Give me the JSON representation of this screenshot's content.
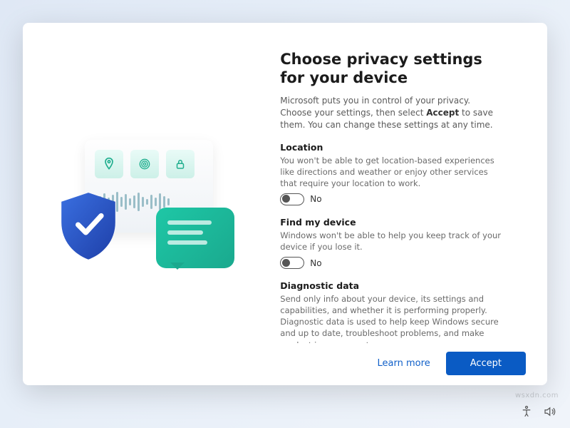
{
  "title": "Choose privacy settings for your device",
  "subtitle_pre": "Microsoft puts you in control of your privacy. Choose your settings, then select ",
  "subtitle_bold": "Accept",
  "subtitle_post": " to save them. You can change these settings at any time.",
  "settings": [
    {
      "name": "Location",
      "desc": "You won't be able to get location-based experiences like directions and weather or enjoy other services that require your location to work.",
      "state_label": "No",
      "has_toggle": true
    },
    {
      "name": "Find my device",
      "desc": "Windows won't be able to help you keep track of your device if you lose it.",
      "state_label": "No",
      "has_toggle": true
    },
    {
      "name": "Diagnostic data",
      "desc": "Send only info about your device, its settings and capabilities, and whether it is performing properly. Diagnostic data is used to help keep Windows secure and up to date, troubleshoot problems, and make product improvements.",
      "state_label": "",
      "has_toggle": false
    }
  ],
  "footer": {
    "learn_more": "Learn more",
    "accept": "Accept"
  },
  "illustration_icons": [
    "pin-icon",
    "fingerprint-icon",
    "lock-icon"
  ],
  "tray_icons": [
    "accessibility-icon",
    "volume-icon"
  ],
  "watermark": "wsxdn.com"
}
